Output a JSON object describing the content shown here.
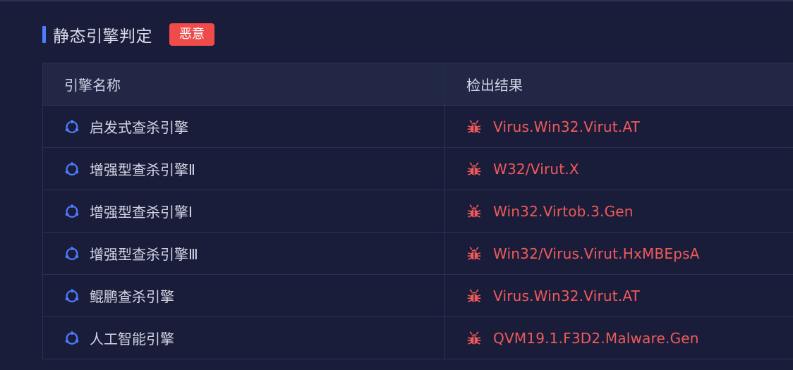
{
  "section": {
    "title": "静态引擎判定",
    "verdict": "恶意"
  },
  "table": {
    "headers": {
      "engine": "引擎名称",
      "result": "检出结果"
    },
    "rows": [
      {
        "engine": "启发式查杀引擎",
        "result": "Virus.Win32.Virut.AT"
      },
      {
        "engine": "增强型查杀引擎Ⅱ",
        "result": "W32/Virut.X"
      },
      {
        "engine": "增强型查杀引擎Ⅰ",
        "result": "Win32.Virtob.3.Gen"
      },
      {
        "engine": "增强型查杀引擎Ⅲ",
        "result": "Win32/Virus.Virut.HxMBEpsA"
      },
      {
        "engine": "鲲鹏查杀引擎",
        "result": "Virus.Win32.Virut.AT"
      },
      {
        "engine": "人工智能引擎",
        "result": "QVM19.1.F3D2.Malware.Gen"
      }
    ]
  },
  "icons": {
    "engine": "engine-cycle-icon",
    "result": "bug-icon"
  },
  "colors": {
    "background": "#1a1d3a",
    "accent": "#4e7bff",
    "malicious": "#ef4b4b",
    "result_text": "#f05a5a"
  }
}
